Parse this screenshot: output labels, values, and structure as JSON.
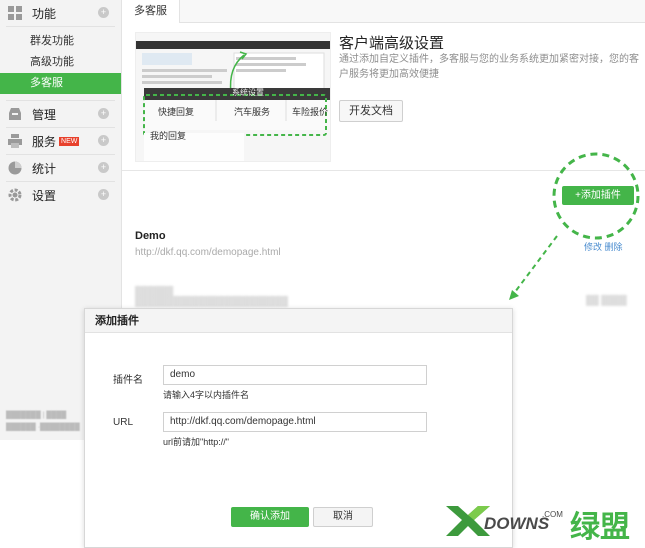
{
  "sidebar": {
    "groups": [
      {
        "label": "功能",
        "icon": "grid-icon"
      },
      {
        "label": "管理",
        "icon": "inbox-icon"
      },
      {
        "label": "服务",
        "icon": "printer-icon",
        "badge": "NEW"
      },
      {
        "label": "统计",
        "icon": "pie-chart-icon"
      },
      {
        "label": "设置",
        "icon": "gear-icon"
      }
    ],
    "sub_items": [
      "群发功能",
      "高级功能",
      "多客服"
    ],
    "active_sub": "多客服",
    "plus_glyph": "+"
  },
  "tab": {
    "label": "多客服"
  },
  "hero": {
    "title": "客户端高级设置",
    "description": "通过添加自定义插件，多客服与您的业务系统更加紧密对接，您的客户服务将更加高效便捷",
    "doc_button": "开发文档",
    "preview_tabs": [
      "快捷回复",
      "汽车服务",
      "车险报价"
    ],
    "preview_title": "系统设置",
    "preview_reply": "我的回复"
  },
  "add_button": "+添加插件",
  "plugin": {
    "name": "Demo",
    "url": "http://dkf.qq.com/demopage.html",
    "actions": "修改  删除"
  },
  "dialog": {
    "title": "添加插件",
    "name_label": "插件名",
    "name_value": "demo",
    "name_hint": "请输入4字以内插件名",
    "url_label": "URL",
    "url_value": "http://dkf.qq.com/demopage.html",
    "url_hint": "url前请加\"http://\"",
    "confirm": "确认添加",
    "cancel": "取消"
  },
  "watermark": {
    "text": "DOWNS",
    "suffix": "绿盟",
    "com": ".COM"
  },
  "colors": {
    "accent": "#44b549",
    "link": "#4a8ccf",
    "badge": "#e8412c"
  }
}
